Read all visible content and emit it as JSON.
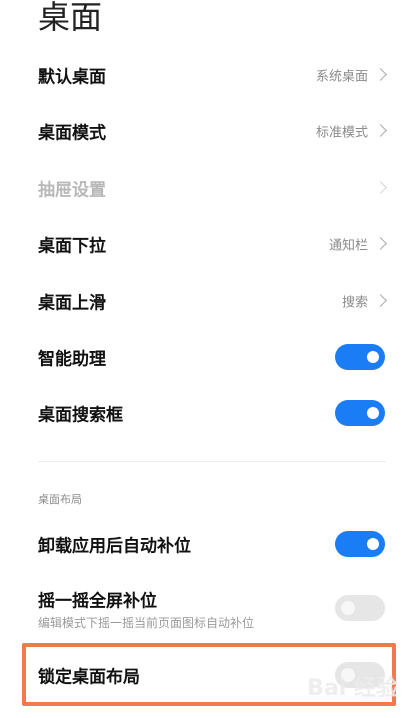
{
  "page": {
    "title": "桌面"
  },
  "settings": {
    "default_desktop": {
      "label": "默认桌面",
      "value": "系统桌面"
    },
    "desktop_mode": {
      "label": "桌面模式",
      "value": "标准模式"
    },
    "drawer_settings": {
      "label": "抽屉设置",
      "enabled": false
    },
    "desktop_pull_down": {
      "label": "桌面下拉",
      "value": "通知栏"
    },
    "desktop_swipe_up": {
      "label": "桌面上滑",
      "value": "搜索"
    },
    "smart_assistant": {
      "label": "智能助理",
      "on": true
    },
    "desktop_search_box": {
      "label": "桌面搜索框",
      "on": true
    }
  },
  "layout_section": {
    "header": "桌面布局",
    "auto_fill_after_uninstall": {
      "label": "卸载应用后自动补位",
      "on": true
    },
    "shake_to_fill": {
      "label": "摇一摇全屏补位",
      "description": "编辑模式下摇一摇当前页面图标自动补位",
      "on": false
    },
    "lock_layout": {
      "label": "锁定桌面布局",
      "on": false
    }
  },
  "watermark": {
    "text": "Bai 经验"
  },
  "colors": {
    "toggle_on": "#1a7df5",
    "toggle_off": "#e6e6e6",
    "highlight": "#f07a4e"
  }
}
